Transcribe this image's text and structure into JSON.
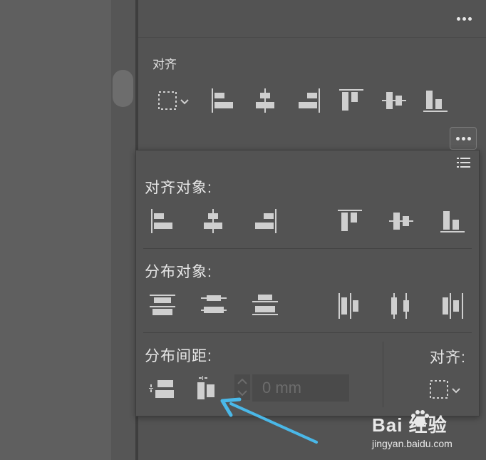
{
  "panel": {
    "title": "对齐",
    "menu_icon": "more-horizontal-icon"
  },
  "popup": {
    "align_objects_label": "对齐对象:",
    "distribute_objects_label": "分布对象:",
    "distribute_spacing_label": "分布间距:",
    "align_to_label": "对齐:",
    "spacing_value": "0 mm"
  },
  "watermark": {
    "main": "Bai 经验",
    "sub": "jingyan.baidu.com"
  },
  "colors": {
    "panel_bg": "#535353",
    "icon": "#cfcfcf",
    "annotation_arrow": "#4ab8e8"
  }
}
